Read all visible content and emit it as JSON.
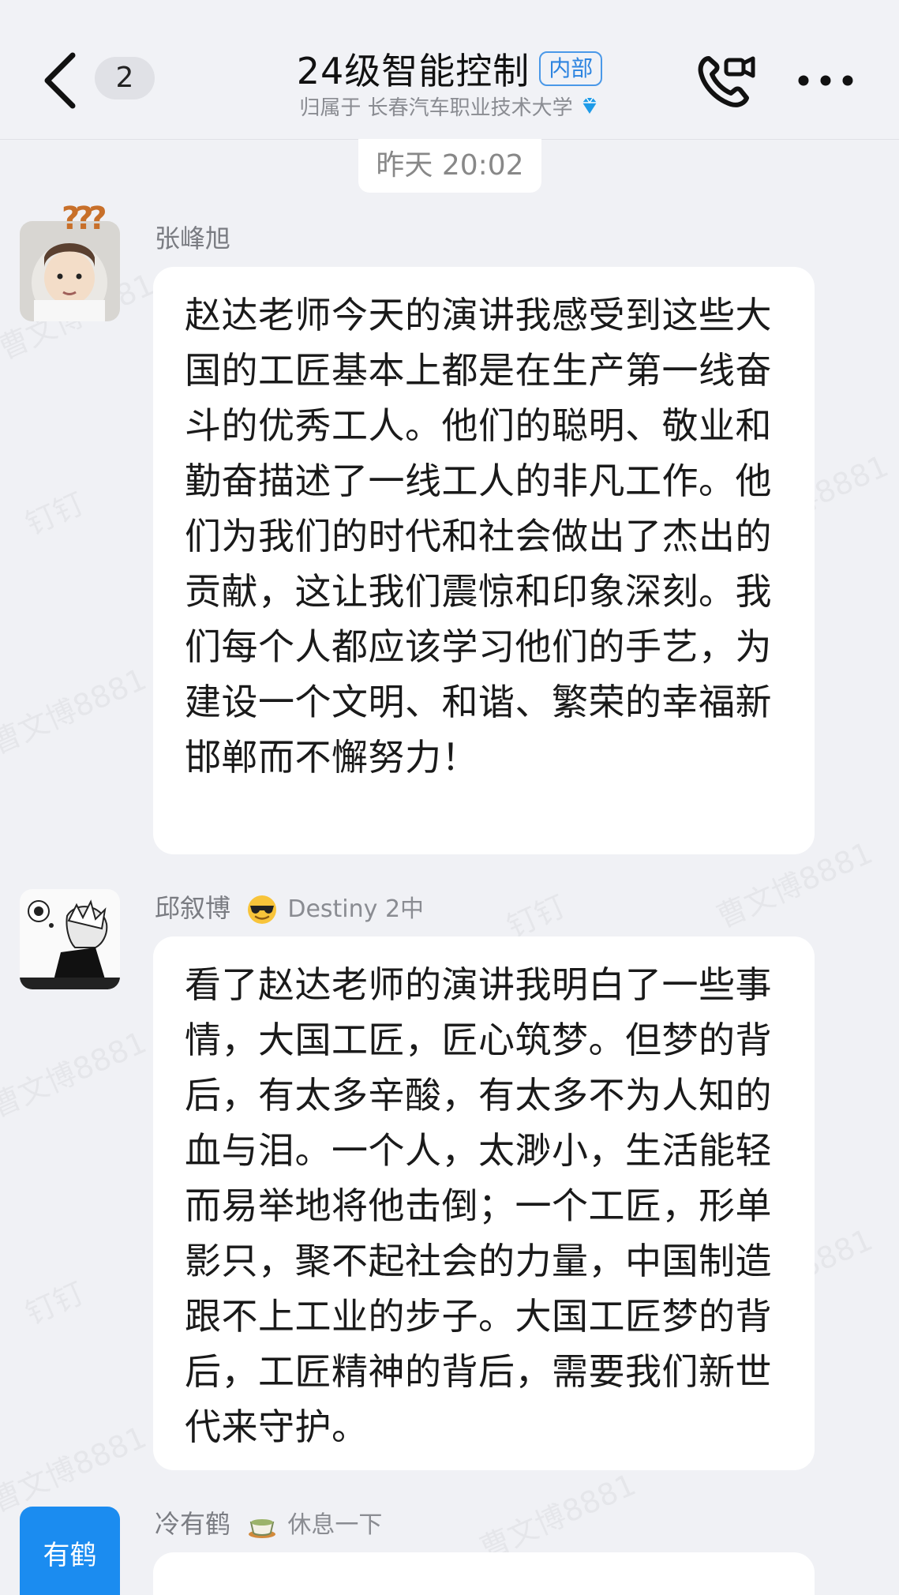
{
  "header": {
    "back_count": "2",
    "title": "24级智能控制",
    "tag": "内部",
    "subtitle": "归属于 长春汽车职业技术大学"
  },
  "timestamp": "昨天 20:02",
  "messages": [
    {
      "sender": "张峰旭",
      "text": "赵达老师今天的演讲我感受到这些大国的工匠基本上都是在生产第一线奋斗的优秀工人。他们的聪明、敬业和勤奋描述了一线工人的非凡工作。他们为我们的时代和社会做出了杰出的贡献，这让我们震惊和印象深刻。我们每个人都应该学习他们的手艺，为建设一个文明、和谐、繁荣的幸福新邯郸而不懈努力！"
    },
    {
      "sender": "邱叙博",
      "status": "Destiny 2中",
      "text": "看了赵达老师的演讲我明白了一些事情，大国工匠，匠心筑梦。但梦的背后，有太多辛酸，有太多不为人知的血与泪。一个人，太渺小，生活能轻而易举地将他击倒；一个工匠，形单影只，聚不起社会的力量，中国制造跟不上工业的步子。大国工匠梦的背后，工匠精神的背后，需要我们新世代来守护。"
    },
    {
      "sender": "冷有鹤",
      "status": "休息一下",
      "avatar_text": "有鹤"
    }
  ],
  "watermarks": [
    "曹文博8881",
    "钉钉"
  ],
  "colors": {
    "accent": "#1b8cf0",
    "tag": "#2d84e0",
    "diamond": "#1e9be8"
  }
}
